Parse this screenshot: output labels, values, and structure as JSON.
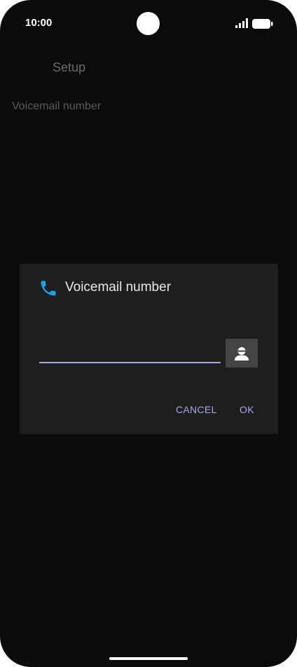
{
  "status_bar": {
    "time": "10:00",
    "signal_icon": "cellular-signal-icon",
    "battery_icon": "battery-icon"
  },
  "screen": {
    "title": "Setup",
    "item_label": "Voicemail number"
  },
  "dialog": {
    "icon": "phone-icon",
    "title": "Voicemail number",
    "input_value": "",
    "contact_icon": "contact-person-icon",
    "cancel_label": "CANCEL",
    "ok_label": "OK"
  },
  "colors": {
    "background": "#0b0b0b",
    "dialog_background": "#1e1e1e",
    "accent": "#a4a8ee",
    "phone_icon": "#1aa3e8"
  }
}
